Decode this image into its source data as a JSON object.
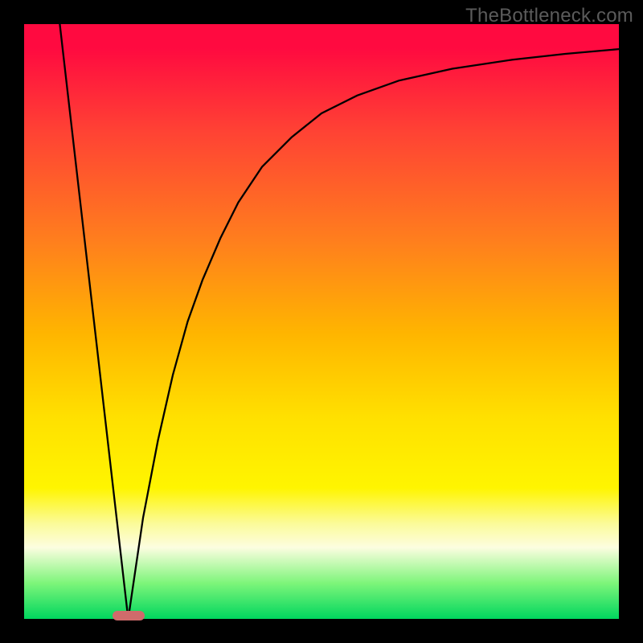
{
  "watermark": "TheBottleneck.com",
  "marker": {
    "color": "#cf6b6b",
    "x_frac": 0.175,
    "y_frac": 0.995
  },
  "chart_data": {
    "type": "line",
    "title": "",
    "xlabel": "",
    "ylabel": "",
    "xlim": [
      0,
      1
    ],
    "ylim": [
      0,
      1
    ],
    "series": [
      {
        "name": "left-line",
        "x": [
          0.06,
          0.175
        ],
        "y": [
          1.0,
          0.0
        ]
      },
      {
        "name": "right-curve",
        "x": [
          0.175,
          0.2,
          0.225,
          0.25,
          0.275,
          0.3,
          0.33,
          0.36,
          0.4,
          0.45,
          0.5,
          0.56,
          0.63,
          0.72,
          0.82,
          0.91,
          1.0
        ],
        "y": [
          0.0,
          0.17,
          0.3,
          0.41,
          0.5,
          0.57,
          0.64,
          0.7,
          0.76,
          0.81,
          0.85,
          0.88,
          0.905,
          0.925,
          0.94,
          0.95,
          0.958
        ]
      }
    ],
    "gradient_stops": [
      {
        "pos": 0.0,
        "color": "#ff0a40"
      },
      {
        "pos": 0.18,
        "color": "#ff4234"
      },
      {
        "pos": 0.36,
        "color": "#ff7d1e"
      },
      {
        "pos": 0.52,
        "color": "#ffb500"
      },
      {
        "pos": 0.66,
        "color": "#ffe000"
      },
      {
        "pos": 0.78,
        "color": "#fff500"
      },
      {
        "pos": 0.88,
        "color": "#fcfde0"
      },
      {
        "pos": 1.0,
        "color": "#00d65e"
      }
    ]
  }
}
